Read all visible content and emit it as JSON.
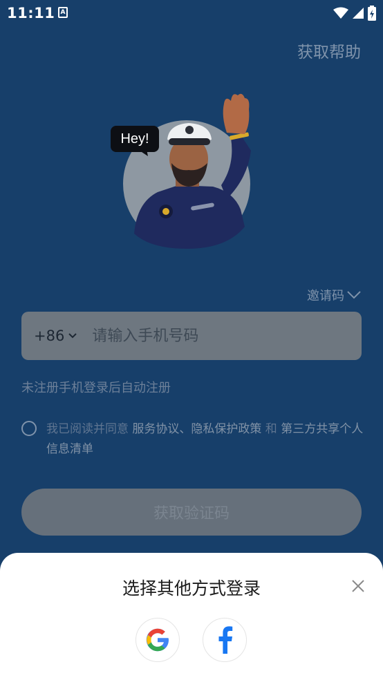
{
  "status_bar": {
    "time": "11:11",
    "a_icon_letter": "A"
  },
  "header": {
    "help_label": "获取帮助"
  },
  "illustration": {
    "bubble_text": "Hey!"
  },
  "invite": {
    "label": "邀请码"
  },
  "phone": {
    "country_code": "+86",
    "placeholder": "请输入手机号码"
  },
  "hint": "未注册手机登录后自动注册",
  "agreement": {
    "prefix": "我已阅读并同意 ",
    "service_link": "服务协议",
    "separator": "、",
    "privacy_link": "隐私保护政策",
    "and": " 和 ",
    "third_party_link": "第三方共享个人信息清单"
  },
  "get_code_label": "获取验证码",
  "sheet": {
    "title": "选择其他方式登录"
  },
  "colors": {
    "background": "#173f6a",
    "sheet": "#ffffff",
    "facebook": "#1877f2"
  }
}
